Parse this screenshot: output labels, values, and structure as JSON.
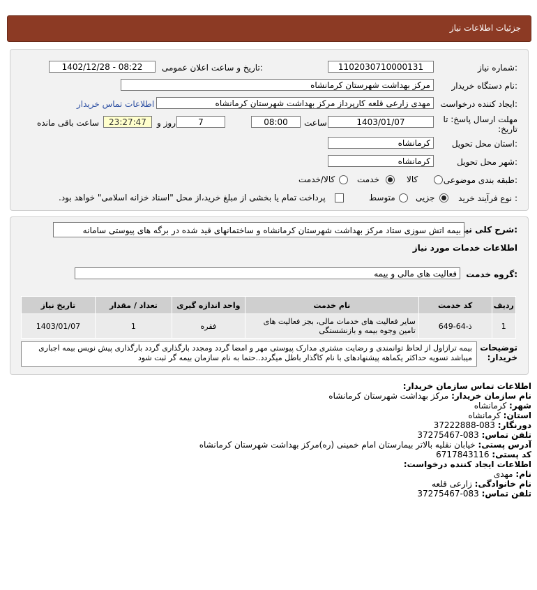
{
  "header": {
    "title": "جزئیات اطلاعات نیاز"
  },
  "form": {
    "need_number_label": "شماره نیاز:",
    "need_number": "1102030710000131",
    "announce_label": "تاریخ و ساعت اعلان عمومی:",
    "announce_value": "1402/12/28 - 08:22",
    "buyer_org_label": "نام دستگاه خریدار:",
    "buyer_org": "مرکز بهداشت شهرستان کرمانشاه",
    "creator_label": "ایجاد کننده درخواست:",
    "creator": "مهدی  زارعی قلعه کارپرداز مرکز بهداشت شهرستان کرمانشاه",
    "contact_link": "اطلاعات تماس خریدار",
    "deadline_label": "مهلت ارسال پاسخ: تا تاریخ:",
    "deadline_date": "1403/01/07",
    "time_label": "ساعت",
    "deadline_time": "08:00",
    "days": "7",
    "days_label": "روز و",
    "remaining": "23:27:47",
    "remaining_label": "ساعت باقی مانده",
    "province_label": "استان محل تحویل:",
    "province": "کرمانشاه",
    "city_label": "شهر محل تحویل:",
    "city": "کرمانشاه",
    "category_label": "طبقه بندی موضوعی:",
    "category_options": [
      "کالا",
      "خدمت",
      "کالا/خدمت"
    ],
    "process_label": "نوع فرآیند خرید :",
    "process_options": [
      "جزیی",
      "متوسط"
    ],
    "payment_note": "پرداخت تمام یا بخشی از مبلغ خرید،از محل \"اسناد خزانه اسلامی\" خواهد بود."
  },
  "details": {
    "summary_label": "شرح کلی نیاز:",
    "summary": "بیمه اتش سوزی ستاد مرکز بهداشت شهرستان کرمانشاه و ساختمانهای قید شده در برگه های پیوستی سامانه",
    "services_title": "اطلاعات خدمات مورد نیاز",
    "service_group_label": "گروه خدمت:",
    "service_group": "فعالیت  های مالی و بیمه",
    "table": {
      "headers": [
        "ردیف",
        "کد خدمت",
        "نام خدمت",
        "واحد اندازه گیری",
        "تعداد / مقدار",
        "تاریخ نیاز"
      ],
      "rows": [
        [
          "1",
          "ذ-64-649",
          "سایر فعالیت های خدمات مالی، بجز فعالیت های تامین وجوه بیمه و بازنشستگی",
          "فقره",
          "1",
          "1403/01/07"
        ]
      ]
    },
    "buyer_notes_label": "توضیحات خریدار:",
    "buyer_notes": "بیمه ترازاول از لحاظ توانمندی و رضایت مشتری مدارک پیوستی مهر و امضا گردد ومجدد بارگذاری گردد بارگذاری پیش نویس بیمه اجباری میباشد تسویه حداکثر یکماهه پیشنهادهای با نام کاگذار باطل میگردد..حتما به نام سازمان بیمه گر ثبت شود"
  },
  "contact": {
    "title": "اطلاعات تماس سازمان خریدار:",
    "org_label": "نام سازمان خریدار:",
    "org": "مرکز بهداشت شهرستان کرمانشاه",
    "city_label": "شهر:",
    "city": "کرمانشاه",
    "province_label": "استان:",
    "province": "کرمانشاه",
    "fax_label": "دورنگار:",
    "fax": "083-37222888",
    "phone_label": "تلفن تماس:",
    "phone": "083-37275467",
    "address_label": "آدرس پستی:",
    "address": "خیابان نقلیه بالاتر بیمارستان امام خمینی (ره)مرکز بهداشت شهرستان کرمانشاه",
    "postal_label": "کد پستی:",
    "postal": "6717843116",
    "creator_title": "اطلاعات ایجاد کننده درخواست:",
    "name_label": "نام:",
    "name": "مهدی",
    "family_label": "نام خانوادگی:",
    "family": "زارعی قلعه",
    "creator_phone_label": "تلفن تماس:",
    "creator_phone": "083-37275467"
  }
}
